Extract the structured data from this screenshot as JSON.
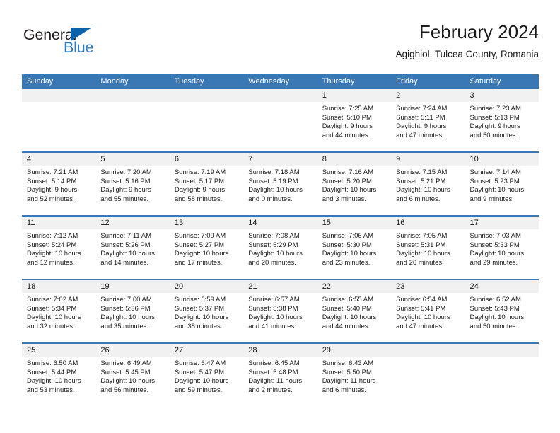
{
  "brand": {
    "name_dark": "General",
    "name_blue": "Blue",
    "accent_color": "#0a62ab",
    "blue_text_color": "#2e7dc4"
  },
  "header": {
    "title": "February 2024",
    "subtitle": "Agighiol, Tulcea County, Romania"
  },
  "calendar": {
    "header_bg": "#3a77b5",
    "date_band_bg": "#f1f1f1",
    "weekdays": [
      "Sunday",
      "Monday",
      "Tuesday",
      "Wednesday",
      "Thursday",
      "Friday",
      "Saturday"
    ],
    "weeks": [
      [
        {
          "day": "",
          "empty": true,
          "sunrise": "",
          "sunset": "",
          "daylight_line1": "",
          "daylight_line2": ""
        },
        {
          "day": "",
          "empty": true,
          "sunrise": "",
          "sunset": "",
          "daylight_line1": "",
          "daylight_line2": ""
        },
        {
          "day": "",
          "empty": true,
          "sunrise": "",
          "sunset": "",
          "daylight_line1": "",
          "daylight_line2": ""
        },
        {
          "day": "",
          "empty": true,
          "sunrise": "",
          "sunset": "",
          "daylight_line1": "",
          "daylight_line2": ""
        },
        {
          "day": "1",
          "empty": false,
          "sunrise": "Sunrise: 7:25 AM",
          "sunset": "Sunset: 5:10 PM",
          "daylight_line1": "Daylight: 9 hours",
          "daylight_line2": "and 44 minutes."
        },
        {
          "day": "2",
          "empty": false,
          "sunrise": "Sunrise: 7:24 AM",
          "sunset": "Sunset: 5:11 PM",
          "daylight_line1": "Daylight: 9 hours",
          "daylight_line2": "and 47 minutes."
        },
        {
          "day": "3",
          "empty": false,
          "sunrise": "Sunrise: 7:23 AM",
          "sunset": "Sunset: 5:13 PM",
          "daylight_line1": "Daylight: 9 hours",
          "daylight_line2": "and 50 minutes."
        }
      ],
      [
        {
          "day": "4",
          "empty": false,
          "sunrise": "Sunrise: 7:21 AM",
          "sunset": "Sunset: 5:14 PM",
          "daylight_line1": "Daylight: 9 hours",
          "daylight_line2": "and 52 minutes."
        },
        {
          "day": "5",
          "empty": false,
          "sunrise": "Sunrise: 7:20 AM",
          "sunset": "Sunset: 5:16 PM",
          "daylight_line1": "Daylight: 9 hours",
          "daylight_line2": "and 55 minutes."
        },
        {
          "day": "6",
          "empty": false,
          "sunrise": "Sunrise: 7:19 AM",
          "sunset": "Sunset: 5:17 PM",
          "daylight_line1": "Daylight: 9 hours",
          "daylight_line2": "and 58 minutes."
        },
        {
          "day": "7",
          "empty": false,
          "sunrise": "Sunrise: 7:18 AM",
          "sunset": "Sunset: 5:19 PM",
          "daylight_line1": "Daylight: 10 hours",
          "daylight_line2": "and 0 minutes."
        },
        {
          "day": "8",
          "empty": false,
          "sunrise": "Sunrise: 7:16 AM",
          "sunset": "Sunset: 5:20 PM",
          "daylight_line1": "Daylight: 10 hours",
          "daylight_line2": "and 3 minutes."
        },
        {
          "day": "9",
          "empty": false,
          "sunrise": "Sunrise: 7:15 AM",
          "sunset": "Sunset: 5:21 PM",
          "daylight_line1": "Daylight: 10 hours",
          "daylight_line2": "and 6 minutes."
        },
        {
          "day": "10",
          "empty": false,
          "sunrise": "Sunrise: 7:14 AM",
          "sunset": "Sunset: 5:23 PM",
          "daylight_line1": "Daylight: 10 hours",
          "daylight_line2": "and 9 minutes."
        }
      ],
      [
        {
          "day": "11",
          "empty": false,
          "sunrise": "Sunrise: 7:12 AM",
          "sunset": "Sunset: 5:24 PM",
          "daylight_line1": "Daylight: 10 hours",
          "daylight_line2": "and 12 minutes."
        },
        {
          "day": "12",
          "empty": false,
          "sunrise": "Sunrise: 7:11 AM",
          "sunset": "Sunset: 5:26 PM",
          "daylight_line1": "Daylight: 10 hours",
          "daylight_line2": "and 14 minutes."
        },
        {
          "day": "13",
          "empty": false,
          "sunrise": "Sunrise: 7:09 AM",
          "sunset": "Sunset: 5:27 PM",
          "daylight_line1": "Daylight: 10 hours",
          "daylight_line2": "and 17 minutes."
        },
        {
          "day": "14",
          "empty": false,
          "sunrise": "Sunrise: 7:08 AM",
          "sunset": "Sunset: 5:29 PM",
          "daylight_line1": "Daylight: 10 hours",
          "daylight_line2": "and 20 minutes."
        },
        {
          "day": "15",
          "empty": false,
          "sunrise": "Sunrise: 7:06 AM",
          "sunset": "Sunset: 5:30 PM",
          "daylight_line1": "Daylight: 10 hours",
          "daylight_line2": "and 23 minutes."
        },
        {
          "day": "16",
          "empty": false,
          "sunrise": "Sunrise: 7:05 AM",
          "sunset": "Sunset: 5:31 PM",
          "daylight_line1": "Daylight: 10 hours",
          "daylight_line2": "and 26 minutes."
        },
        {
          "day": "17",
          "empty": false,
          "sunrise": "Sunrise: 7:03 AM",
          "sunset": "Sunset: 5:33 PM",
          "daylight_line1": "Daylight: 10 hours",
          "daylight_line2": "and 29 minutes."
        }
      ],
      [
        {
          "day": "18",
          "empty": false,
          "sunrise": "Sunrise: 7:02 AM",
          "sunset": "Sunset: 5:34 PM",
          "daylight_line1": "Daylight: 10 hours",
          "daylight_line2": "and 32 minutes."
        },
        {
          "day": "19",
          "empty": false,
          "sunrise": "Sunrise: 7:00 AM",
          "sunset": "Sunset: 5:36 PM",
          "daylight_line1": "Daylight: 10 hours",
          "daylight_line2": "and 35 minutes."
        },
        {
          "day": "20",
          "empty": false,
          "sunrise": "Sunrise: 6:59 AM",
          "sunset": "Sunset: 5:37 PM",
          "daylight_line1": "Daylight: 10 hours",
          "daylight_line2": "and 38 minutes."
        },
        {
          "day": "21",
          "empty": false,
          "sunrise": "Sunrise: 6:57 AM",
          "sunset": "Sunset: 5:38 PM",
          "daylight_line1": "Daylight: 10 hours",
          "daylight_line2": "and 41 minutes."
        },
        {
          "day": "22",
          "empty": false,
          "sunrise": "Sunrise: 6:55 AM",
          "sunset": "Sunset: 5:40 PM",
          "daylight_line1": "Daylight: 10 hours",
          "daylight_line2": "and 44 minutes."
        },
        {
          "day": "23",
          "empty": false,
          "sunrise": "Sunrise: 6:54 AM",
          "sunset": "Sunset: 5:41 PM",
          "daylight_line1": "Daylight: 10 hours",
          "daylight_line2": "and 47 minutes."
        },
        {
          "day": "24",
          "empty": false,
          "sunrise": "Sunrise: 6:52 AM",
          "sunset": "Sunset: 5:43 PM",
          "daylight_line1": "Daylight: 10 hours",
          "daylight_line2": "and 50 minutes."
        }
      ],
      [
        {
          "day": "25",
          "empty": false,
          "sunrise": "Sunrise: 6:50 AM",
          "sunset": "Sunset: 5:44 PM",
          "daylight_line1": "Daylight: 10 hours",
          "daylight_line2": "and 53 minutes."
        },
        {
          "day": "26",
          "empty": false,
          "sunrise": "Sunrise: 6:49 AM",
          "sunset": "Sunset: 5:45 PM",
          "daylight_line1": "Daylight: 10 hours",
          "daylight_line2": "and 56 minutes."
        },
        {
          "day": "27",
          "empty": false,
          "sunrise": "Sunrise: 6:47 AM",
          "sunset": "Sunset: 5:47 PM",
          "daylight_line1": "Daylight: 10 hours",
          "daylight_line2": "and 59 minutes."
        },
        {
          "day": "28",
          "empty": false,
          "sunrise": "Sunrise: 6:45 AM",
          "sunset": "Sunset: 5:48 PM",
          "daylight_line1": "Daylight: 11 hours",
          "daylight_line2": "and 2 minutes."
        },
        {
          "day": "29",
          "empty": false,
          "sunrise": "Sunrise: 6:43 AM",
          "sunset": "Sunset: 5:50 PM",
          "daylight_line1": "Daylight: 11 hours",
          "daylight_line2": "and 6 minutes."
        },
        {
          "day": "",
          "empty": true,
          "sunrise": "",
          "sunset": "",
          "daylight_line1": "",
          "daylight_line2": ""
        },
        {
          "day": "",
          "empty": true,
          "sunrise": "",
          "sunset": "",
          "daylight_line1": "",
          "daylight_line2": ""
        }
      ]
    ]
  }
}
